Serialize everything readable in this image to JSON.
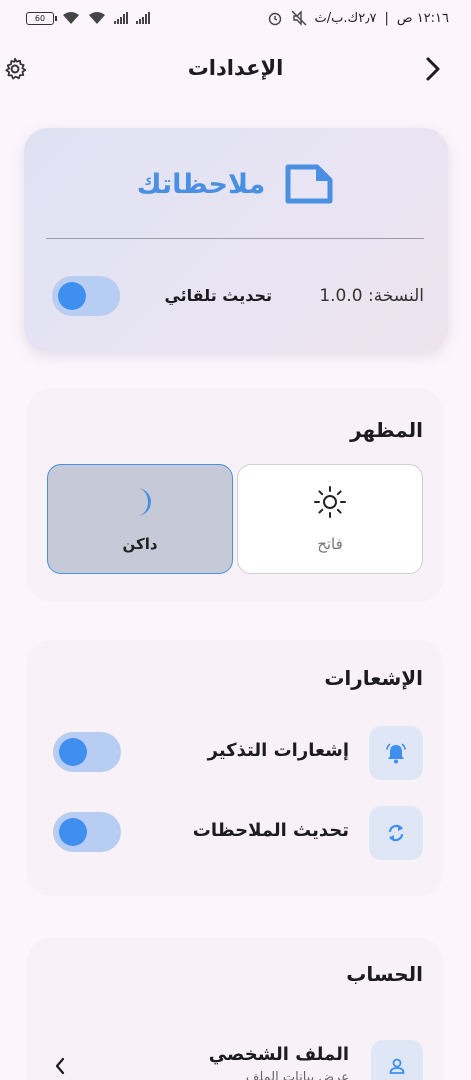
{
  "status_bar": {
    "time": "١٢:١٦ ص",
    "speed": "٢٫٧ك.ب/ث",
    "battery": "60"
  },
  "header": {
    "title": "الإعدادات"
  },
  "app_card": {
    "app_name": "ملاحظاتك",
    "version": "النسخة: 1.0.0",
    "auto_update_label": "تحديث تلقائي",
    "auto_update_on": true
  },
  "appearance": {
    "title": "المظهر",
    "light_label": "فاتح",
    "dark_label": "داكن",
    "selected": "dark"
  },
  "notifications": {
    "title": "الإشعارات",
    "items": [
      {
        "label": "إشعارات التذكير",
        "icon": "bell-ringing-icon",
        "on": true
      },
      {
        "label": "تحديث الملاحظات",
        "icon": "sync-icon",
        "on": true
      }
    ]
  },
  "account": {
    "title": "الحساب",
    "profile_label": "الملف الشخصي",
    "profile_sub": "عرض بيانات الملف"
  },
  "colors": {
    "accent": "#4a90e2",
    "toggle_track": "#b7cdf2",
    "toggle_knob": "#3f8ff0",
    "background": "#fcf6fc"
  }
}
